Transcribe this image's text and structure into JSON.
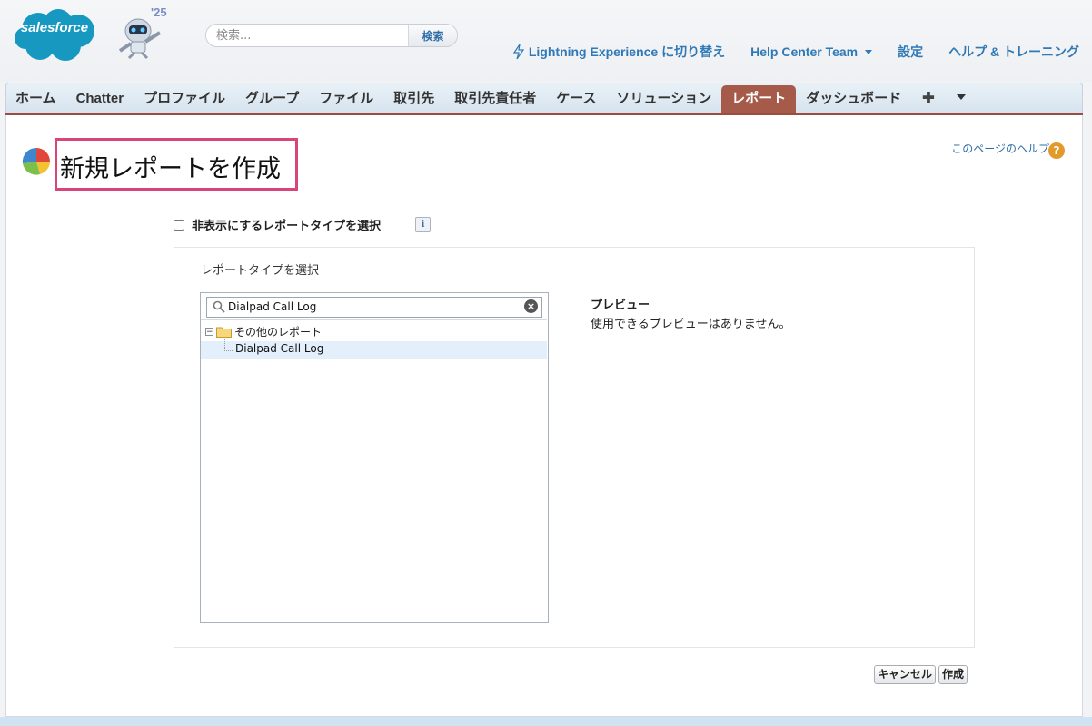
{
  "header": {
    "logo_text": "salesforce",
    "release_badge": "'25",
    "search": {
      "placeholder": "検索...",
      "button_label": "検索"
    },
    "links": {
      "lightning": "Lightning Experience に切り替え",
      "user": "Help Center Team",
      "setup": "設定",
      "help": "ヘルプ & トレーニング"
    }
  },
  "tabs": [
    {
      "label": "ホーム"
    },
    {
      "label": "Chatter"
    },
    {
      "label": "プロファイル"
    },
    {
      "label": "グループ"
    },
    {
      "label": "ファイル"
    },
    {
      "label": "取引先"
    },
    {
      "label": "取引先責任者"
    },
    {
      "label": "ケース"
    },
    {
      "label": "ソリューション"
    },
    {
      "label": "レポート",
      "active": true
    },
    {
      "label": "ダッシュボード"
    }
  ],
  "page": {
    "title": "新規レポートを作成",
    "help_link": "このページのヘルプ",
    "hidden_types_checkbox": {
      "label": "非表示にするレポートタイプを選択",
      "checked": false
    },
    "select_type_label": "レポートタイプを選択",
    "tree": {
      "search_value": "Dialpad Call Log",
      "folder": "その他のレポート",
      "items": [
        "Dialpad Call Log"
      ]
    },
    "preview": {
      "title": "プレビュー",
      "text": "使用できるプレビューはありません。"
    },
    "buttons": {
      "cancel": "キャンセル",
      "create": "作成"
    }
  },
  "colors": {
    "active_tab": "#a65a4a",
    "link": "#2f79b6",
    "title_highlight_border": "#d7457a",
    "tab_underline": "#9b4d3f"
  }
}
